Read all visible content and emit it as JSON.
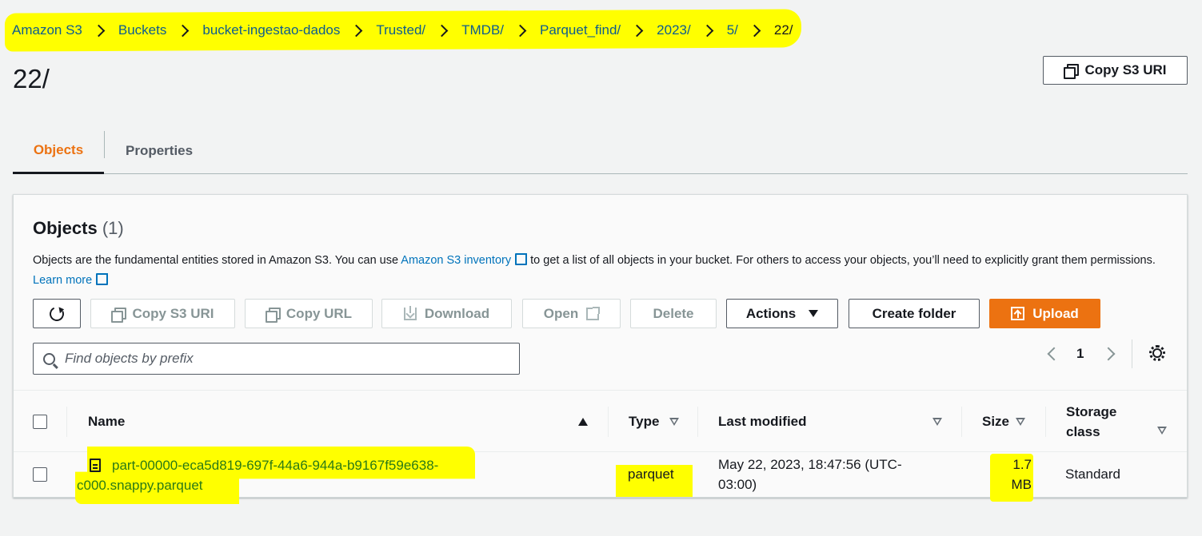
{
  "breadcrumb": {
    "items": [
      "Amazon S3",
      "Buckets",
      "bucket-ingestao-dados",
      "Trusted/",
      "TMDB/",
      "Parquet_find/",
      "2023/",
      "5/",
      "22/"
    ]
  },
  "header": {
    "title": "22/",
    "copy_s3_uri": "Copy S3 URI"
  },
  "tabs": [
    {
      "label": "Objects",
      "active": true
    },
    {
      "label": "Properties",
      "active": false
    }
  ],
  "objects_panel": {
    "title": "Objects",
    "count": "(1)",
    "desc_before": "Objects are the fundamental entities stored in Amazon S3. You can use ",
    "inventory_link": "Amazon S3 inventory",
    "desc_after": " to get a list of all objects in your bucket. For others to access your objects, you’ll need to explicitly grant them permissions.",
    "learn_more": "Learn more"
  },
  "toolbar": {
    "copy_s3_uri": "Copy S3 URI",
    "copy_url": "Copy URL",
    "download": "Download",
    "open": "Open",
    "delete": "Delete",
    "actions": "Actions",
    "create_folder": "Create folder",
    "upload": "Upload"
  },
  "search": {
    "placeholder": "Find objects by prefix",
    "value": ""
  },
  "pagination": {
    "current_page": "1"
  },
  "table": {
    "columns": {
      "name": "Name",
      "type": "Type",
      "last_modified": "Last modified",
      "size": "Size",
      "storage_class_1": "Storage",
      "storage_class_2": "class"
    },
    "rows": [
      {
        "name_line1": "part-00000-eca5d819-697f-44a6-944a-b9167f59e638-",
        "name_line2": "c000.snappy.parquet",
        "type": "parquet",
        "last_modified_line1": "May 22, 2023, 18:47:56 (UTC-",
        "last_modified_line2": "03:00)",
        "size_line1": "1.7",
        "size_line2": "MB",
        "storage_class": "Standard"
      }
    ]
  },
  "colors": {
    "accent": "#ec7211",
    "link": "#0073bb",
    "highlight": "#ffff00",
    "background": "#f2f3f3"
  }
}
